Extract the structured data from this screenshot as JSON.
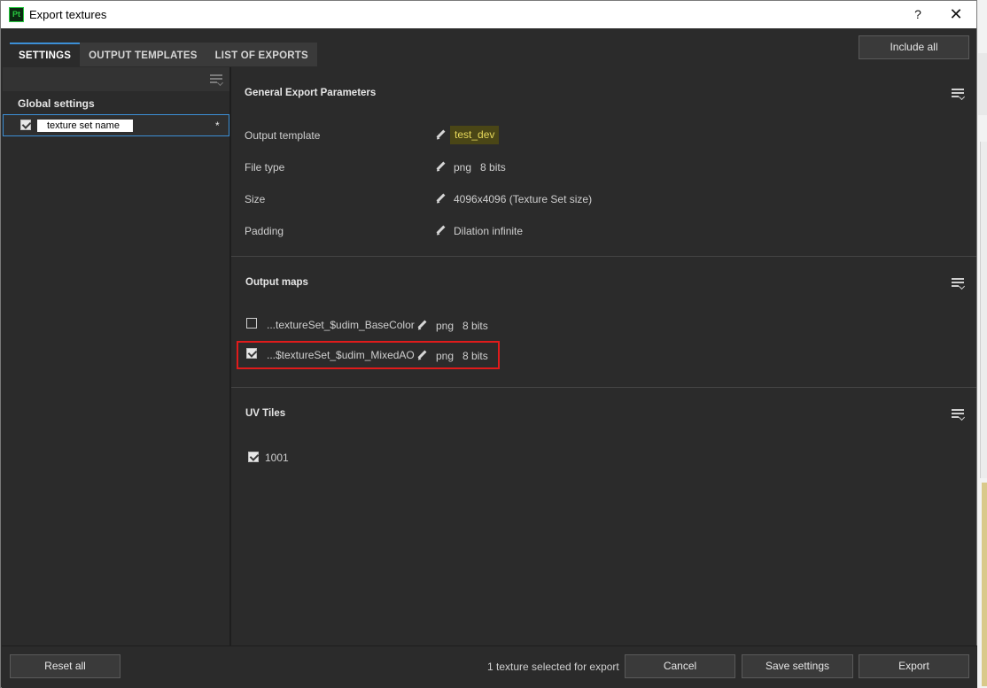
{
  "window": {
    "title": "Export textures",
    "app_icon": "Pt",
    "help": "?",
    "close": "✕"
  },
  "tabs": [
    {
      "label": "SETTINGS",
      "active": true
    },
    {
      "label": "OUTPUT TEMPLATES",
      "active": false
    },
    {
      "label": "LIST OF EXPORTS",
      "active": false
    }
  ],
  "include_all_label": "Include all",
  "left": {
    "global_settings": "Global settings",
    "texture_set": {
      "name": "texture set name",
      "checked": true,
      "modified_marker": "*"
    }
  },
  "general": {
    "title": "General Export Parameters",
    "params": [
      {
        "label": "Output template",
        "value": "test_dev"
      },
      {
        "label": "File type",
        "value": "png   8 bits"
      },
      {
        "label": "Size",
        "value": "4096x4096 (Texture Set size)"
      },
      {
        "label": "Padding",
        "value": "Dilation infinite"
      }
    ]
  },
  "output_maps": {
    "title": "Output maps",
    "maps": [
      {
        "name": "...textureSet_$udim_BaseColor",
        "format": "png   8 bits",
        "checked": false
      },
      {
        "name": "...$textureSet_$udim_MixedAO",
        "format": "png   8 bits",
        "checked": true,
        "highlighted": true
      }
    ]
  },
  "uv_tiles": {
    "title": "UV Tiles",
    "tiles": [
      {
        "label": "1001",
        "checked": true
      }
    ]
  },
  "footer": {
    "reset_label": "Reset all",
    "status": "1 texture selected for export",
    "cancel_label": "Cancel",
    "save_label": "Save settings",
    "export_label": "Export"
  },
  "colors": {
    "accent": "#3c8fd6",
    "highlight_box": "#e01b1b",
    "template_bg": "#4a4616",
    "template_text": "#e6d85a"
  }
}
